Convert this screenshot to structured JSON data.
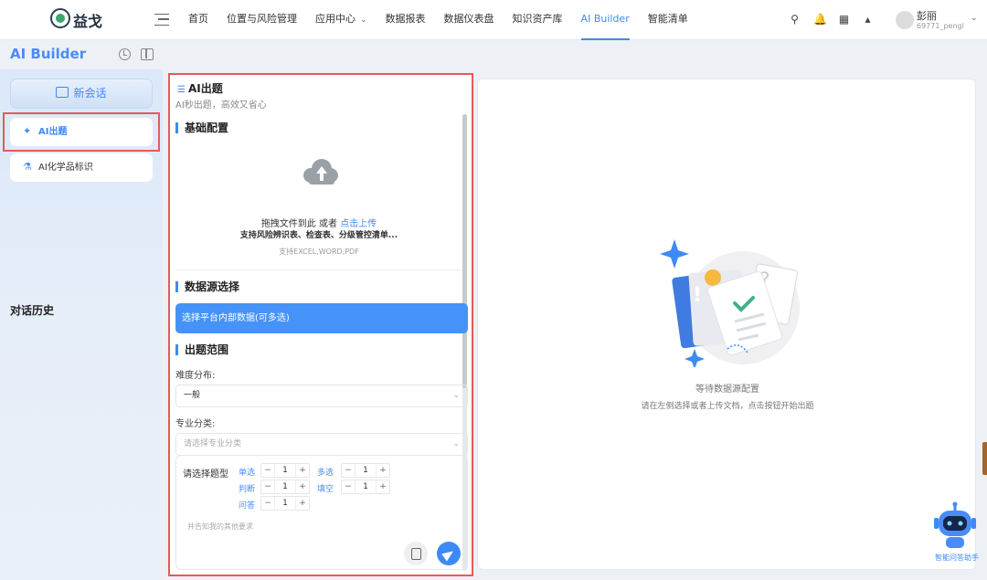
{
  "header": {
    "brand": "益戈",
    "nav": [
      {
        "label": "首页"
      },
      {
        "label": "位置与风险管理"
      },
      {
        "label": "应用中心"
      },
      {
        "label": "数据报表"
      },
      {
        "label": "数据仪表盘"
      },
      {
        "label": "知识资产库"
      },
      {
        "label": "AI Builder"
      },
      {
        "label": "智能清单"
      }
    ],
    "active_nav": "AI Builder",
    "user": {
      "name": "彭丽",
      "id": "69771_pengl"
    },
    "icons": [
      "search-icon",
      "bell-icon",
      "qrcode-icon",
      "chart-icon"
    ]
  },
  "sidebar": {
    "title": "AI Builder",
    "new_chat": "新会话",
    "items": [
      {
        "label": "AI出题",
        "icon": "sparkle-icon",
        "active": true
      },
      {
        "label": "AI化学品标识",
        "icon": "flask-icon",
        "active": false
      }
    ],
    "history_label": "对话历史"
  },
  "form": {
    "title": "AI出题",
    "subtitle": "AI秒出题，高效又省心",
    "basic_config": "基础配置",
    "upload": {
      "prompt": "拖拽文件到此 或者",
      "link": "点击上传",
      "hint": "支持风险辨识表、检查表、分级管控清单...",
      "formats": "支持EXCEL,WORD,PDF"
    },
    "data_source": "数据源选择",
    "data_source_button": "选择平台内部数据(可多选)",
    "scope": "出题范围",
    "difficulty_label": "难度分布:",
    "difficulty_value": "一般",
    "category_label": "专业分类:",
    "category_placeholder": "请选择专业分类",
    "qtype_label": "请选择题型",
    "qtypes": [
      {
        "label": "单选",
        "value": "1"
      },
      {
        "label": "多选",
        "value": "1"
      },
      {
        "label": "判断",
        "value": "1"
      },
      {
        "label": "填空",
        "value": "1"
      },
      {
        "label": "问答",
        "value": "1"
      }
    ],
    "stepper_minus": "−",
    "stepper_plus": "+",
    "request_placeholder": "并告知我的其他要求"
  },
  "result": {
    "empty_title": "等待数据源配置",
    "empty_hint": "请在左侧选择或者上传文档，点击按钮开始出题"
  },
  "assistant": {
    "label": "智能问答助手"
  },
  "colors": {
    "accent": "#3d8af7",
    "highlight": "#e55a5a"
  }
}
